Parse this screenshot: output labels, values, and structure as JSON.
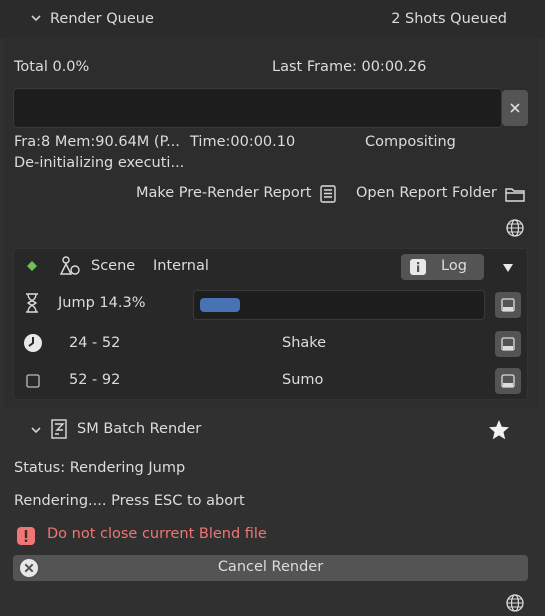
{
  "render_queue": {
    "title": "Render Queue",
    "shots_queued": "2 Shots Queued",
    "total": "Total 0.0%",
    "last_frame": "Last Frame: 00:00.26",
    "stats": "Fra:8 Mem:90.64M (P...",
    "time": "Time:00:00.10",
    "stage": "Compositing",
    "status_line": "De-initializing executi...",
    "make_report_label": "Make Pre-Render Report",
    "open_folder_label": "Open Report Folder"
  },
  "scene_row": {
    "scene_label": "Scene",
    "engine": "Internal",
    "log_label": "Log"
  },
  "jobs": [
    {
      "label": "Jump 14.3%",
      "progress": 0.143
    },
    {
      "range": "24 - 52",
      "name": "Shake"
    },
    {
      "range": "52 - 92",
      "name": "Sumo"
    }
  ],
  "batch": {
    "title": "SM Batch Render",
    "status": "Status: Rendering Jump",
    "rendering": "Rendering.... Press ESC to abort",
    "warning": "Do not close current Blend file",
    "cancel_label": "Cancel Render"
  },
  "colors": {
    "accent": "#4772b3",
    "warning": "#f07575",
    "active_dot": "#6fbf5a"
  }
}
